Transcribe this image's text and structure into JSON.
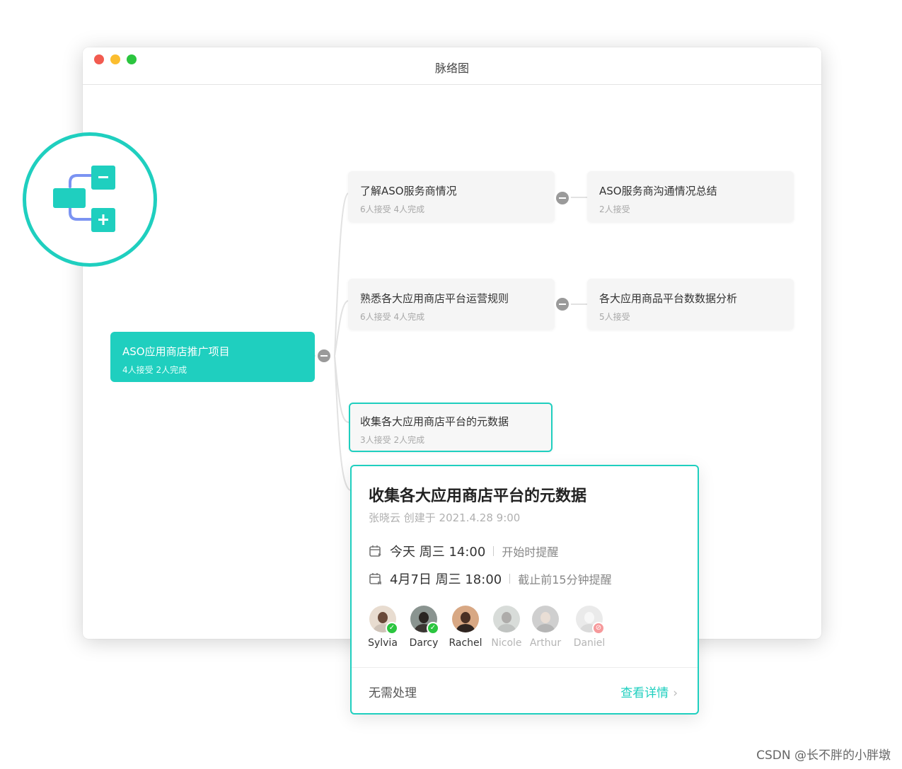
{
  "window": {
    "title": "脉络图"
  },
  "mindmap": {
    "root": {
      "title": "ASO应用商店推广项目",
      "stats": "4人接受  2人完成"
    },
    "children": [
      {
        "title": "了解ASO服务商情况",
        "stats": "6人接受  4人完成",
        "child": {
          "title": "ASO服务商沟通情况总结",
          "stats": "2人接受"
        }
      },
      {
        "title": "熟悉各大应用商店平台运营规则",
        "stats": "6人接受  4人完成",
        "child": {
          "title": "各大应用商品平台数数据分析",
          "stats": "5人接受"
        }
      },
      {
        "title": "收集各大应用商店平台的元数据",
        "stats": "3人接受  2人完成"
      }
    ]
  },
  "popup": {
    "title": "收集各大应用商店平台的元数据",
    "meta": "张晓云  创建于  2021.4.28   9:00",
    "start": {
      "time": "今天  周三  14:00",
      "reminder": "开始时提醒"
    },
    "due": {
      "time": "4月7日  周三  18:00",
      "reminder": "截止前15分钟提醒"
    },
    "people": [
      {
        "name": "Sylvia",
        "status": "done"
      },
      {
        "name": "Darcy",
        "status": "done"
      },
      {
        "name": "Rachel",
        "status": "none"
      },
      {
        "name": "Nicole",
        "status": "pending"
      },
      {
        "name": "Arthur",
        "status": "pending"
      },
      {
        "name": "Daniel",
        "status": "rejected"
      }
    ],
    "status_text": "无需处理",
    "detail_link": "查看详情"
  },
  "watermark": "CSDN @长不胖的小胖墩",
  "colors": {
    "accent": "#1fcfbf",
    "badge_blue": "#7b93f2"
  },
  "icons": {
    "badge": "mindmap-icon"
  }
}
